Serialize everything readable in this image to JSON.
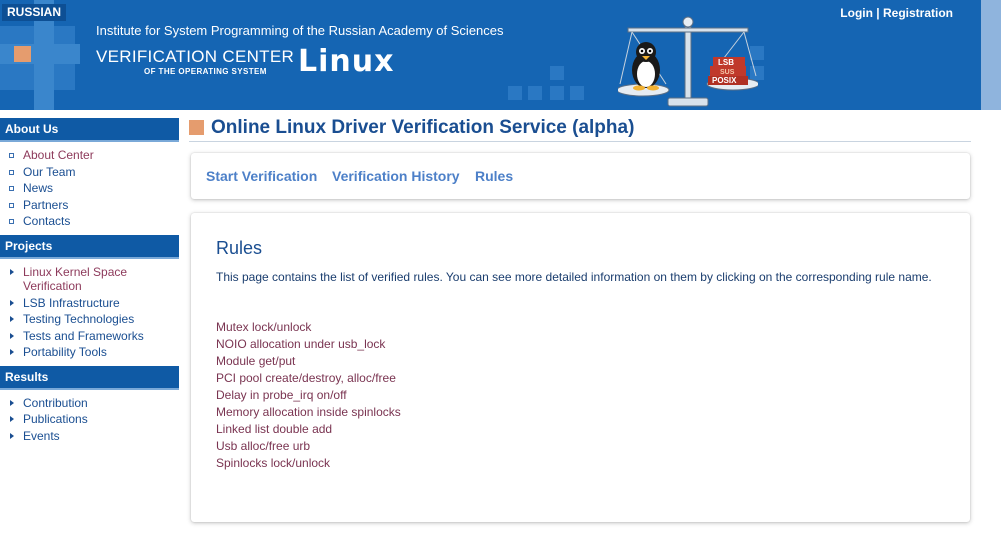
{
  "header": {
    "language_button": "RUSSIAN",
    "institute": "Institute for System Programming of the Russian Academy of Sciences",
    "center_title": "VERIFICATION CENTER",
    "center_subtitle": "OF THE OPERATING SYSTEM",
    "center_linux": "Linux",
    "login": "Login",
    "separator": "|",
    "registration": "Registration",
    "scales_labels": [
      "LSB",
      "SUS",
      "POSIX"
    ]
  },
  "sidebar": {
    "about": {
      "heading": "About Us",
      "items": [
        "About Center",
        "Our Team",
        "News",
        "Partners",
        "Contacts"
      ]
    },
    "projects": {
      "heading": "Projects",
      "items": [
        "Linux Kernel Space Verification",
        "LSB Infrastructure",
        "Testing Technologies",
        "Tests and Frameworks",
        "Portability Tools"
      ]
    },
    "results": {
      "heading": "Results",
      "items": [
        "Contribution",
        "Publications",
        "Events"
      ]
    }
  },
  "main": {
    "title": "Online Linux Driver Verification Service (alpha)",
    "nav": [
      "Start Verification",
      "Verification History",
      "Rules"
    ],
    "rules_heading": "Rules",
    "rules_description": "This page contains the list of verified rules. You can see more detailed information on them by clicking on the corresponding rule name.",
    "rules": [
      "Mutex lock/unlock",
      "NOIO allocation under usb_lock",
      "Module get/put",
      "PCI pool create/destroy, alloc/free",
      "Delay in probe_irq on/off",
      "Memory allocation inside spinlocks",
      "Linked list double add",
      "Usb alloc/free urb",
      "Spinlocks lock/unlock"
    ]
  },
  "colors": {
    "header_blue": "#1565b3",
    "accent_orange": "#e59c6e",
    "link_blue": "#4d80c8",
    "rule_link": "#7a3451"
  }
}
